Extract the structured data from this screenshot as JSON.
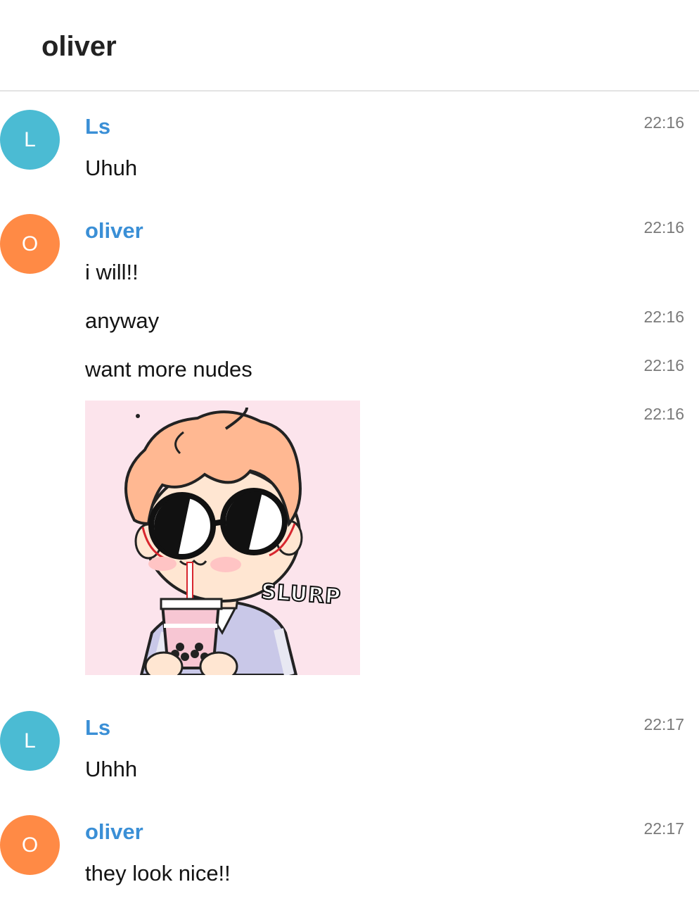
{
  "header": {
    "title": "oliver"
  },
  "colors": {
    "ls_avatar": "#4bbbd3",
    "oliver_avatar": "#ff8a45",
    "sender_name": "#3a8fd6",
    "timestamp": "#7a7a7a",
    "sticker_bg": "#fce4ec"
  },
  "messages": [
    {
      "sender": "Ls",
      "avatar_letter": "L",
      "text": "Uhuh",
      "time": "22:16"
    },
    {
      "sender": "oliver",
      "avatar_letter": "O",
      "text": "i will!!",
      "time": "22:16"
    },
    {
      "text": "anyway",
      "time": "22:16"
    },
    {
      "text": "want more nudes",
      "time": "22:16"
    },
    {
      "sticker": {
        "icon": "sticker-boy-drinking-boba-image",
        "caption": "SLURP"
      },
      "time": "22:16"
    },
    {
      "sender": "Ls",
      "avatar_letter": "L",
      "text": "Uhhh",
      "time": "22:17"
    },
    {
      "sender": "oliver",
      "avatar_letter": "O",
      "text": "they look nice!!",
      "time": "22:17"
    }
  ]
}
